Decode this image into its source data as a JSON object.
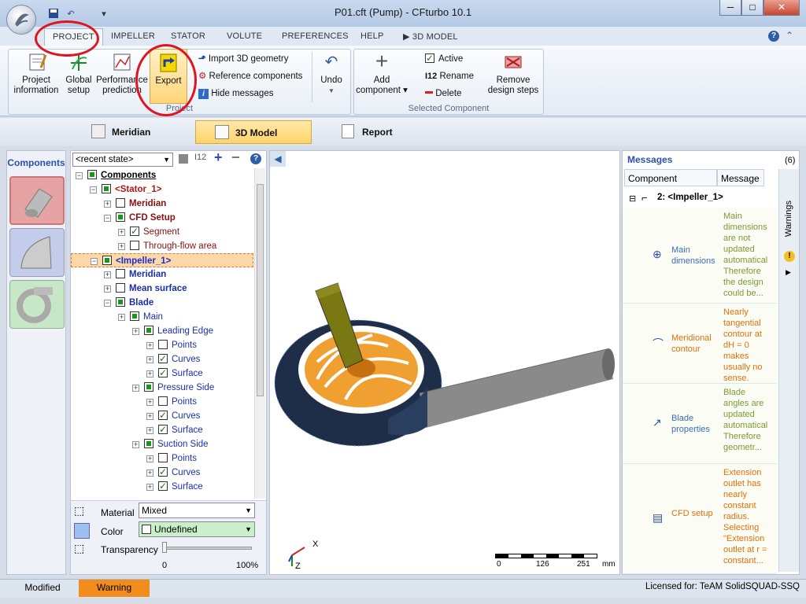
{
  "window": {
    "title": "P01.cft (Pump) - CFturbo 10.1",
    "minimize": "─",
    "maximize": "□",
    "close": "✕",
    "help": "?"
  },
  "tabs": [
    "PROJECT",
    "IMPELLER",
    "STATOR",
    "VOLUTE",
    "PREFERENCES",
    "HELP",
    "▶ 3D MODEL"
  ],
  "ribbon": {
    "project_group": {
      "label": "Project",
      "project_information": "Project information",
      "global_setup": "Global setup",
      "performance_prediction": "Performance prediction",
      "export": "Export",
      "import_3d": "Import 3D geometry",
      "reference_components": "Reference components",
      "hide_messages": "Hide messages",
      "undo": "Undo"
    },
    "selected_group": {
      "label": "Selected Component",
      "add_component": "Add component",
      "active": "Active",
      "rename": "Rename",
      "delete": "Delete",
      "remove_design_steps": "Remove design steps"
    }
  },
  "view_tabs": [
    "Meridian",
    "3D Model",
    "Report"
  ],
  "components_label": "Components",
  "tree": {
    "state": "<recent state>",
    "rows": [
      {
        "text": "Components",
        "indent": 0,
        "style": "root",
        "check": "full"
      },
      {
        "text": "<Stator_1>",
        "indent": 1,
        "style": "stator",
        "check": "full"
      },
      {
        "text": "Meridian",
        "indent": 2,
        "style": "red",
        "check": "none"
      },
      {
        "text": "CFD Setup",
        "indent": 2,
        "style": "red",
        "check": "full"
      },
      {
        "text": "Segment",
        "indent": 3,
        "style": "redlight",
        "check": "tick"
      },
      {
        "text": "Through-flow area",
        "indent": 3,
        "style": "redlight",
        "check": "none"
      },
      {
        "text": "<Impeller_1>",
        "indent": 1,
        "style": "impeller",
        "check": "full"
      },
      {
        "text": "Meridian",
        "indent": 2,
        "style": "blue",
        "check": "none"
      },
      {
        "text": "Mean surface",
        "indent": 2,
        "style": "blue",
        "check": "none"
      },
      {
        "text": "Blade",
        "indent": 2,
        "style": "blue",
        "check": "full"
      },
      {
        "text": "Main",
        "indent": 3,
        "style": "bluelight",
        "check": "full"
      },
      {
        "text": "Leading Edge",
        "indent": 4,
        "style": "bluelight",
        "check": "full"
      },
      {
        "text": "Points",
        "indent": 5,
        "style": "bluelight",
        "check": "none"
      },
      {
        "text": "Curves",
        "indent": 5,
        "style": "bluelight",
        "check": "tick"
      },
      {
        "text": "Surface",
        "indent": 5,
        "style": "bluelight",
        "check": "tick"
      },
      {
        "text": "Pressure Side",
        "indent": 4,
        "style": "bluelight",
        "check": "full"
      },
      {
        "text": "Points",
        "indent": 5,
        "style": "bluelight",
        "check": "none"
      },
      {
        "text": "Curves",
        "indent": 5,
        "style": "bluelight",
        "check": "tick"
      },
      {
        "text": "Surface",
        "indent": 5,
        "style": "bluelight",
        "check": "tick"
      },
      {
        "text": "Suction Side",
        "indent": 4,
        "style": "bluelight",
        "check": "full"
      },
      {
        "text": "Points",
        "indent": 5,
        "style": "bluelight",
        "check": "none"
      },
      {
        "text": "Curves",
        "indent": 5,
        "style": "bluelight",
        "check": "tick"
      },
      {
        "text": "Surface",
        "indent": 5,
        "style": "bluelight",
        "check": "tick"
      }
    ],
    "material_label": "Material",
    "material_value": "Mixed",
    "color_label": "Color",
    "color_value": "Undefined",
    "transparency_label": "Transparency",
    "transparency_min": "0",
    "transparency_max": "100%"
  },
  "viewport": {
    "scale_ticks": [
      "0",
      "126",
      "251",
      "mm"
    ],
    "axis_x": "X",
    "axis_z": "Z"
  },
  "messages": {
    "title": "Messages",
    "count": "(6)",
    "col_component": "Component",
    "col_message": "Message",
    "group": "2: <Impeller_1>",
    "warnings_label": "Warnings",
    "items": [
      {
        "component": "Main dimensions",
        "text": "Main dimensions are not updated automatically. Therefore the design could be..."
      },
      {
        "component": "Meridional contour",
        "text": "Nearly tangential contour at dH = 0 makes usually no sense."
      },
      {
        "component": "Blade properties",
        "text": "Blade angles are updated automatically. Therefore geometr..."
      },
      {
        "component": "CFD setup",
        "text": "Extension outlet has nearly constant radius. Selecting \"Extension outlet at r = constant..."
      }
    ]
  },
  "status": {
    "modified": "Modified",
    "warning": "Warning",
    "license": "Licensed for: TeAM SolidSQUAD-SSQ"
  }
}
